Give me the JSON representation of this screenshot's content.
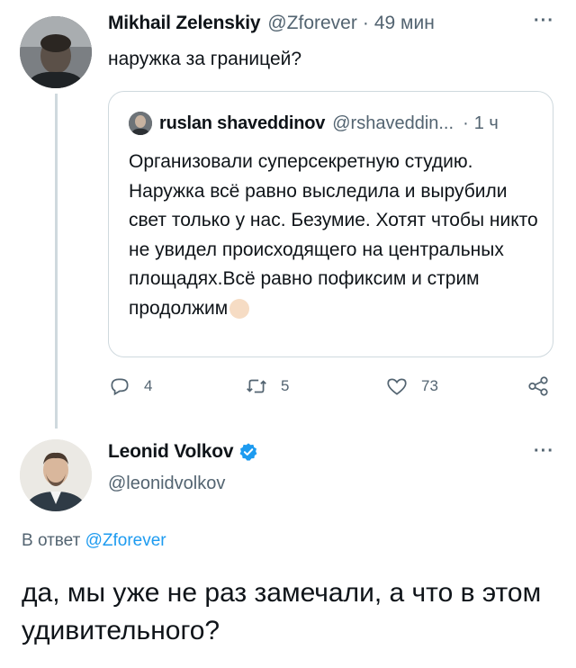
{
  "original_tweet": {
    "author_name": "Mikhail Zelenskiy",
    "handle": "@Zforever",
    "separator": "·",
    "time": "49 мин",
    "more": "···",
    "text": "наружка за границей?"
  },
  "quoted_tweet": {
    "author_name": "ruslan shaveddinov",
    "handle": "@rshaveddin...",
    "separator": "·",
    "time": "1 ч",
    "text": "Организовали суперсекретную студию. Наружка всё равно выследила и вырубили свет только у нас. Безумие. Хотят чтобы никто не увидел происходящего на центральных площадях.Всё равно пофиксим и стрим продолжим",
    "emoji": "raised-fist-light-skin"
  },
  "actions": {
    "reply_count": "4",
    "retweet_count": "5",
    "like_count": "73"
  },
  "reply_tweet": {
    "author_name": "Leonid Volkov",
    "handle": "@leonidvolkov",
    "more": "···",
    "reply_prefix": "В ответ",
    "reply_to": "@Zforever",
    "text": "да, мы уже не раз замечали, а что в этом удивительного?"
  },
  "colors": {
    "accent": "#1d9bf0",
    "muted": "#536471",
    "border": "#cfd9de"
  }
}
